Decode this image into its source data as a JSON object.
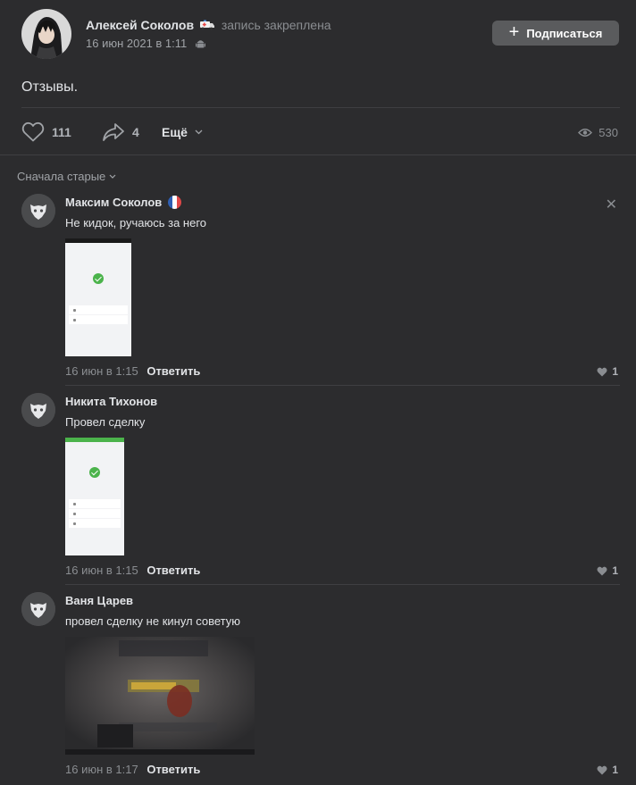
{
  "post": {
    "author_name": "Алексей Соколов",
    "pinned_label": "запись закреплена",
    "date": "16 июн 2021 в 1:11",
    "subscribe_label": "Подписаться",
    "text": "Отзывы.",
    "likes": "111",
    "shares": "4",
    "more_label": "Ещё",
    "views": "530"
  },
  "comments_sort_label": "Сначала старые",
  "comments": [
    {
      "name": "Максим Соколов",
      "text": "Не кидок, ручаюсь за него",
      "date": "16 июн в 1:15",
      "reply_label": "Ответить",
      "likes": "1"
    },
    {
      "name": "Никита Тихонов",
      "text": "Провел сделку",
      "date": "16 июн в 1:15",
      "reply_label": "Ответить",
      "likes": "1"
    },
    {
      "name": "Ваня Царев",
      "text": "провел сделку не кинул советую",
      "date": "16 июн в 1:17",
      "reply_label": "Ответить",
      "likes": "1"
    }
  ],
  "colors": {
    "background": "#2c2c2e",
    "text_primary": "#e1e3e6",
    "text_secondary": "#8a8d91",
    "button_bg": "#5a5b5d",
    "success_green": "#4bb34b"
  },
  "icons": {
    "like": "heart-icon",
    "share": "share-arrow-icon",
    "views": "eye-icon",
    "close": "close-icon",
    "dropdown": "chevron-down-icon",
    "platform": "android-icon"
  }
}
